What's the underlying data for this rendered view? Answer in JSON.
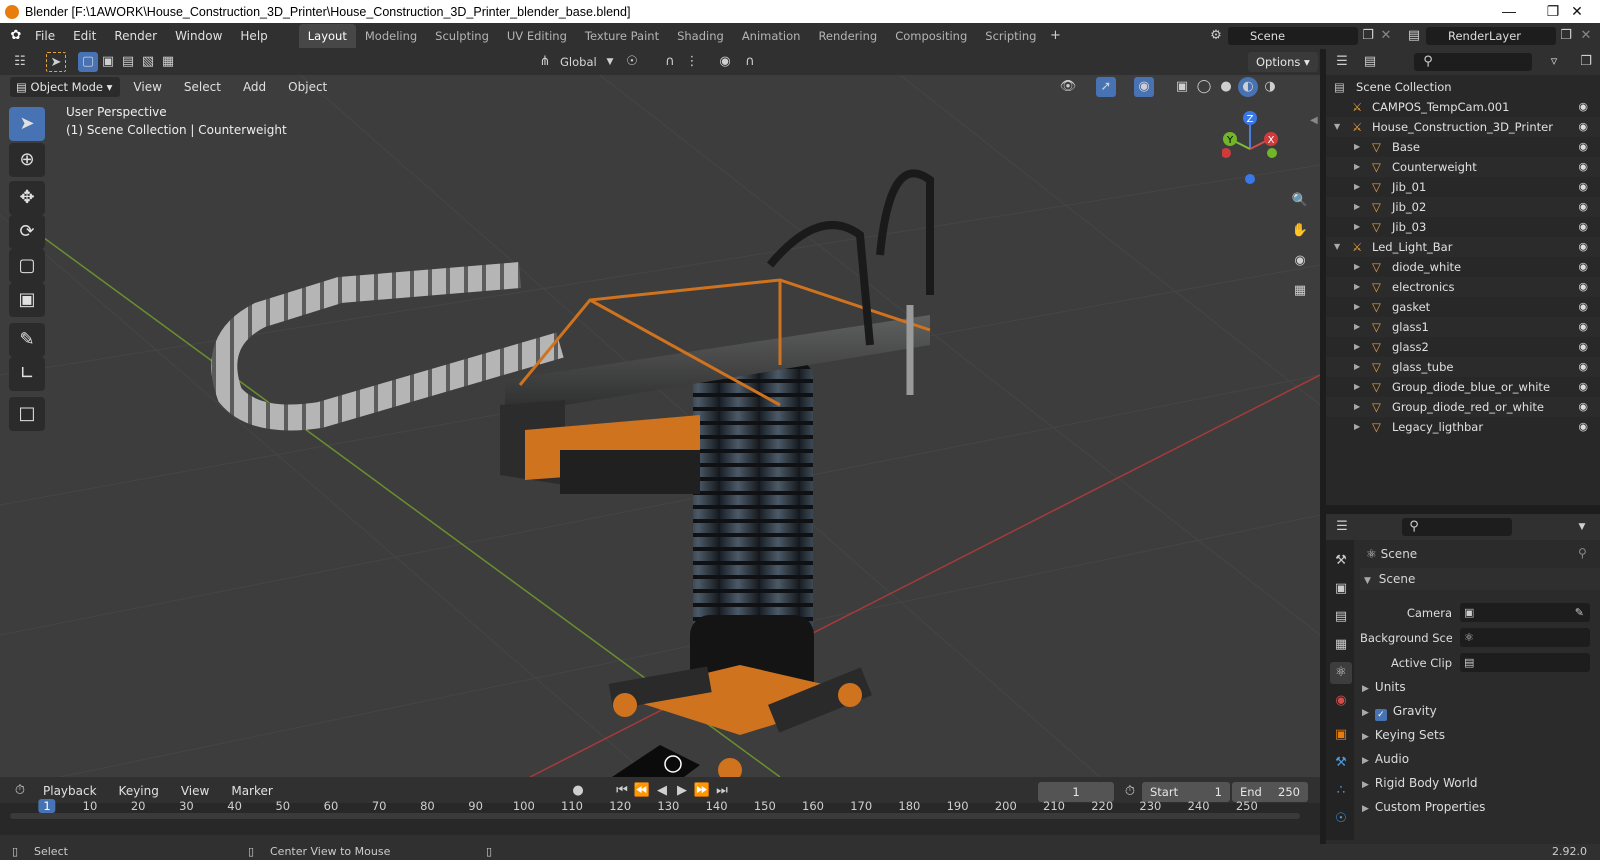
{
  "window": {
    "title": "Blender [F:\\1AWORK\\House_Construction_3D_Printer\\House_Construction_3D_Printer_blender_base.blend]"
  },
  "menus": [
    "File",
    "Edit",
    "Render",
    "Window",
    "Help"
  ],
  "workspaces": [
    "Layout",
    "Modeling",
    "Sculpting",
    "UV Editing",
    "Texture Paint",
    "Shading",
    "Animation",
    "Rendering",
    "Compositing",
    "Scripting"
  ],
  "active_workspace": "Layout",
  "scene_field": "Scene",
  "renderlayer_field": "RenderLayer",
  "tool_header": {
    "orientation": "Global",
    "options": "Options"
  },
  "viewport_header": {
    "mode": "Object Mode",
    "menus": [
      "View",
      "Select",
      "Add",
      "Object"
    ]
  },
  "viewport": {
    "perspective": "User Perspective",
    "context": "(1) Scene Collection | Counterweight",
    "gizmo": {
      "z": "Z",
      "y": "Y",
      "x": "X"
    }
  },
  "outliner": {
    "root": "Scene Collection",
    "items": [
      {
        "label": "CAMPOS_TempCam.001",
        "indent": 0
      },
      {
        "label": "House_Construction_3D_Printer",
        "indent": 0
      },
      {
        "label": "Base",
        "indent": 1
      },
      {
        "label": "Counterweight",
        "indent": 1
      },
      {
        "label": "Jib_01",
        "indent": 1
      },
      {
        "label": "Jib_02",
        "indent": 1
      },
      {
        "label": "Jib_03",
        "indent": 1
      },
      {
        "label": "Led_Light_Bar",
        "indent": 0
      },
      {
        "label": "diode_white",
        "indent": 1
      },
      {
        "label": "electronics",
        "indent": 1
      },
      {
        "label": "gasket",
        "indent": 1
      },
      {
        "label": "glass1",
        "indent": 1
      },
      {
        "label": "glass2",
        "indent": 1
      },
      {
        "label": "glass_tube",
        "indent": 1
      },
      {
        "label": "Group_diode_blue_or_white",
        "indent": 1
      },
      {
        "label": "Group_diode_red_or_white",
        "indent": 1
      },
      {
        "label": "Legacy_ligthbar",
        "indent": 1
      }
    ]
  },
  "properties": {
    "context": "Scene",
    "section": "Scene",
    "fields": {
      "camera": "Camera",
      "background": "Background Sce...",
      "clip": "Active Clip"
    },
    "panels": [
      "Units",
      "Gravity",
      "Keying Sets",
      "Audio",
      "Rigid Body World",
      "Custom Properties"
    ]
  },
  "timeline": {
    "menus": [
      "Playback",
      "Keying",
      "View",
      "Marker"
    ],
    "current_frame": "1",
    "start_label": "Start",
    "start": "1",
    "end_label": "End",
    "end": "250",
    "ticks": [
      "1",
      "10",
      "20",
      "30",
      "40",
      "50",
      "60",
      "70",
      "80",
      "90",
      "100",
      "110",
      "120",
      "130",
      "140",
      "150",
      "160",
      "170",
      "180",
      "190",
      "200",
      "210",
      "220",
      "230",
      "240",
      "250"
    ]
  },
  "statusbar": {
    "select": "Select",
    "center": "Center View to Mouse",
    "version": "2.92.0"
  },
  "colors": {
    "accent": "#4772b3",
    "orange": "#e87d0d",
    "bg": "#3d3d3d",
    "panel": "#303030"
  }
}
